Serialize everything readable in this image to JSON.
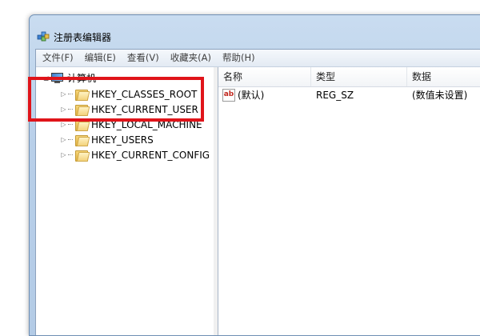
{
  "window": {
    "title": "注册表编辑器"
  },
  "menu": {
    "items": [
      "文件(F)",
      "编辑(E)",
      "查看(V)",
      "收藏夹(A)",
      "帮助(H)"
    ]
  },
  "tree": {
    "root_label": "计算机",
    "root_icon": "computer-icon",
    "children": [
      {
        "label": "HKEY_CLASSES_ROOT",
        "icon": "folder-icon"
      },
      {
        "label": "HKEY_CURRENT_USER",
        "icon": "folder-icon",
        "highlighted": true
      },
      {
        "label": "HKEY_LOCAL_MACHINE",
        "icon": "folder-icon"
      },
      {
        "label": "HKEY_USERS",
        "icon": "folder-icon"
      },
      {
        "label": "HKEY_CURRENT_CONFIG",
        "icon": "folder-icon"
      }
    ]
  },
  "list": {
    "columns": [
      "名称",
      "类型",
      "数据"
    ],
    "rows": [
      {
        "name": "(默认)",
        "type": "REG_SZ",
        "data": "(数值未设置)",
        "icon": "string-value-icon",
        "icon_text": "ab"
      }
    ]
  },
  "colors": {
    "highlight_border": "#e0141a",
    "title_bar": "#b8cfe9"
  }
}
